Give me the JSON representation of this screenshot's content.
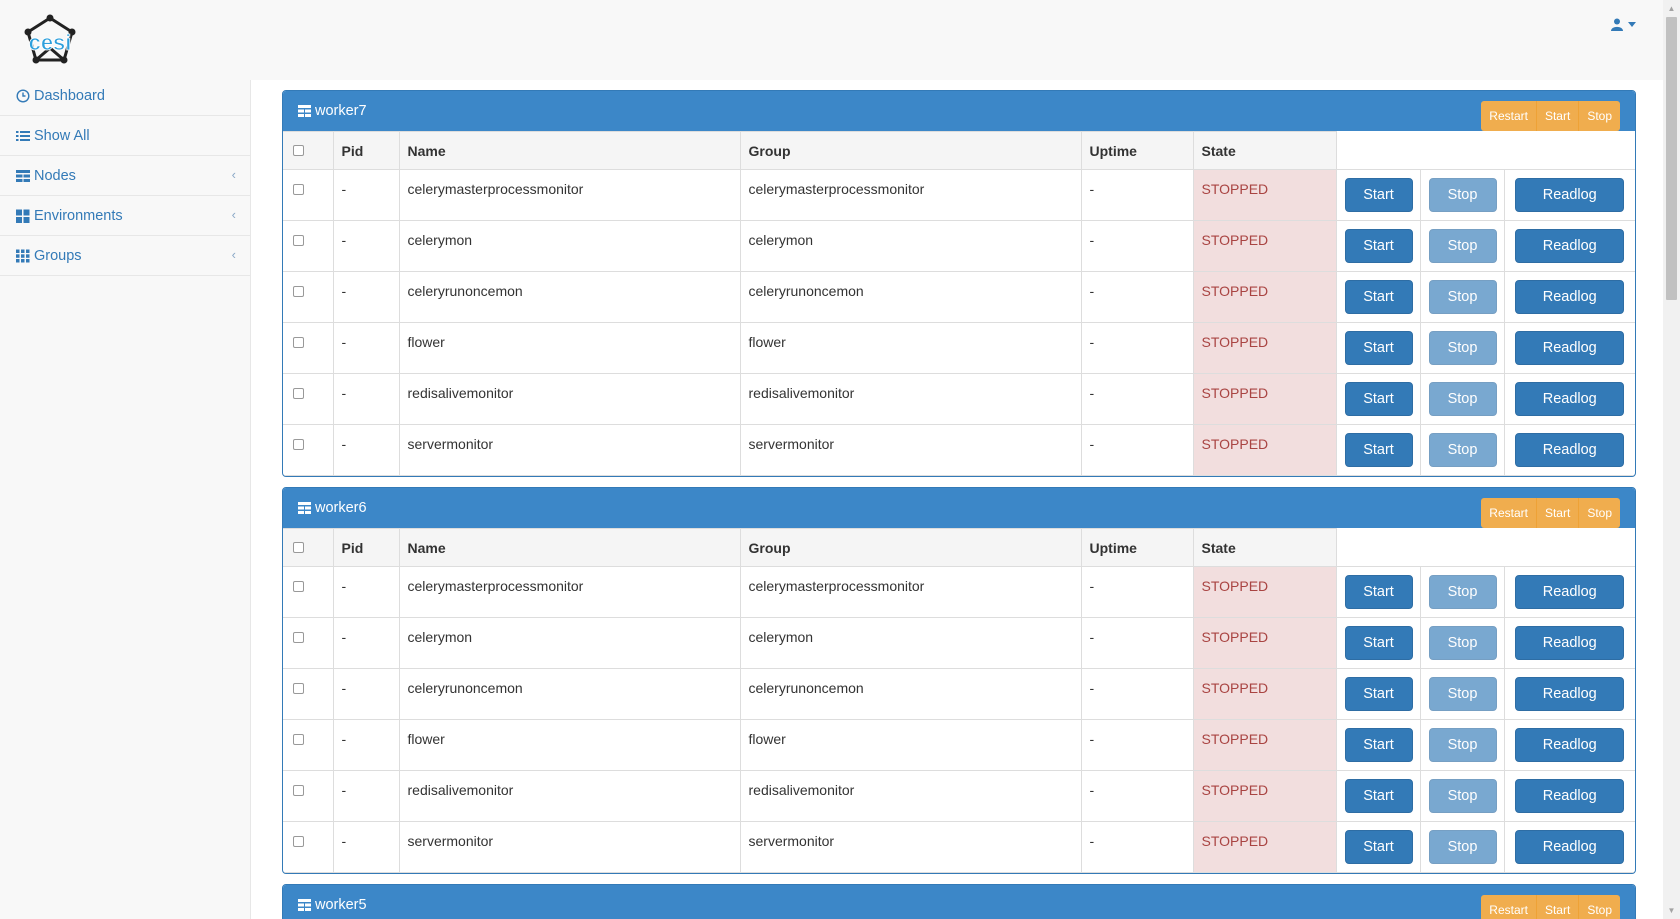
{
  "app": {
    "logo_text": "cesi"
  },
  "sidebar": {
    "items": [
      {
        "label": "Dashboard",
        "icon": "clock-icon",
        "has_submenu": false
      },
      {
        "label": "Show All",
        "icon": "list-icon",
        "has_submenu": false
      },
      {
        "label": "Nodes",
        "icon": "table-icon",
        "has_submenu": true
      },
      {
        "label": "Environments",
        "icon": "grid-icon",
        "has_submenu": true
      },
      {
        "label": "Groups",
        "icon": "columns-icon",
        "has_submenu": true
      }
    ]
  },
  "table": {
    "headers": {
      "pid": "Pid",
      "name": "Name",
      "group": "Group",
      "uptime": "Uptime",
      "state": "State"
    }
  },
  "panel_actions": {
    "restart": "Restart",
    "start": "Start",
    "stop": "Stop"
  },
  "row_buttons": {
    "start": "Start",
    "stop": "Stop",
    "readlog": "Readlog"
  },
  "colors": {
    "primary": "#337ab7",
    "warning": "#f0ad4e",
    "danger_bg": "#f2dede",
    "danger_text": "#a94442"
  },
  "nodes": [
    {
      "name": "worker7",
      "processes": [
        {
          "pid": "-",
          "name": "celerymasterprocessmonitor",
          "group": "celerymasterprocessmonitor",
          "uptime": "-",
          "state": "STOPPED"
        },
        {
          "pid": "-",
          "name": "celerymon",
          "group": "celerymon",
          "uptime": "-",
          "state": "STOPPED"
        },
        {
          "pid": "-",
          "name": "celeryrunoncemon",
          "group": "celeryrunoncemon",
          "uptime": "-",
          "state": "STOPPED"
        },
        {
          "pid": "-",
          "name": "flower",
          "group": "flower",
          "uptime": "-",
          "state": "STOPPED"
        },
        {
          "pid": "-",
          "name": "redisalivemonitor",
          "group": "redisalivemonitor",
          "uptime": "-",
          "state": "STOPPED"
        },
        {
          "pid": "-",
          "name": "servermonitor",
          "group": "servermonitor",
          "uptime": "-",
          "state": "STOPPED"
        }
      ]
    },
    {
      "name": "worker6",
      "processes": [
        {
          "pid": "-",
          "name": "celerymasterprocessmonitor",
          "group": "celerymasterprocessmonitor",
          "uptime": "-",
          "state": "STOPPED"
        },
        {
          "pid": "-",
          "name": "celerymon",
          "group": "celerymon",
          "uptime": "-",
          "state": "STOPPED"
        },
        {
          "pid": "-",
          "name": "celeryrunoncemon",
          "group": "celeryrunoncemon",
          "uptime": "-",
          "state": "STOPPED"
        },
        {
          "pid": "-",
          "name": "flower",
          "group": "flower",
          "uptime": "-",
          "state": "STOPPED"
        },
        {
          "pid": "-",
          "name": "redisalivemonitor",
          "group": "redisalivemonitor",
          "uptime": "-",
          "state": "STOPPED"
        },
        {
          "pid": "-",
          "name": "servermonitor",
          "group": "servermonitor",
          "uptime": "-",
          "state": "STOPPED"
        }
      ]
    },
    {
      "name": "worker5",
      "processes": []
    }
  ]
}
